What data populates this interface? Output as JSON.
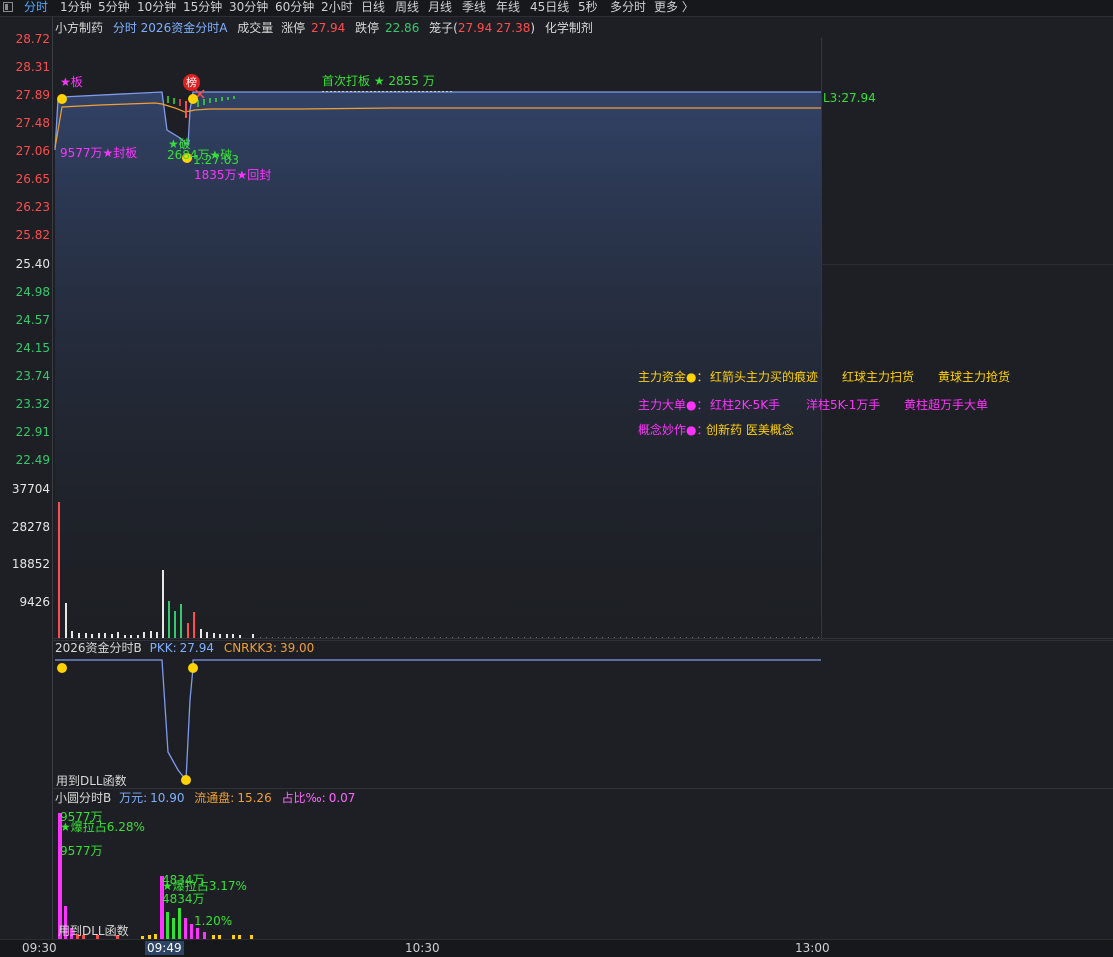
{
  "tabs": {
    "active_index": 0,
    "items": [
      "分时",
      "1分钟",
      "5分钟",
      "10分钟",
      "15分钟",
      "30分钟",
      "60分钟",
      "2小时",
      "日线",
      "周线",
      "月线",
      "季线",
      "年线",
      "45日线",
      "5秒",
      "多分时",
      "更多 〉"
    ]
  },
  "header": {
    "stock_name": "小方制药",
    "indicator": "分时 2026资金分时A",
    "volume_label": "成交量",
    "limit_up_label": "涨停",
    "limit_up_value": "27.94",
    "limit_down_label": "跌停",
    "limit_down_value": "22.86",
    "cage_label": "笼子(",
    "cage_value": "27.94 27.38",
    "cage_close": ")",
    "industry": "化学制剂"
  },
  "price_axis": [
    {
      "label": "28.72",
      "kind": "up"
    },
    {
      "label": "28.31",
      "kind": "up"
    },
    {
      "label": "27.89",
      "kind": "up"
    },
    {
      "label": "27.48",
      "kind": "up"
    },
    {
      "label": "27.06",
      "kind": "up"
    },
    {
      "label": "26.65",
      "kind": "up"
    },
    {
      "label": "26.23",
      "kind": "up"
    },
    {
      "label": "25.82",
      "kind": "up"
    },
    {
      "label": "25.40",
      "kind": "neutral"
    },
    {
      "label": "24.98",
      "kind": "down"
    },
    {
      "label": "24.57",
      "kind": "down"
    },
    {
      "label": "24.15",
      "kind": "down"
    },
    {
      "label": "23.74",
      "kind": "down"
    },
    {
      "label": "23.32",
      "kind": "down"
    },
    {
      "label": "22.91",
      "kind": "down"
    },
    {
      "label": "22.49",
      "kind": "down"
    }
  ],
  "volume_axis": [
    "37704",
    "28278",
    "18852",
    "9426"
  ],
  "annotations": {
    "board_star": "★板",
    "seal_text": "9577万★封板",
    "break_text": "★破",
    "break_text2": "2684万★破",
    "low_text": "1:27.03",
    "reseal_text": "1835万★回封",
    "bang_badge": "榜",
    "first_board": "首次打板 ★ 2855 万",
    "price_tag": "L3:27.94"
  },
  "legend_box": {
    "row1": [
      "主力资金●：",
      "红箭头主力买的痕迹",
      "红球主力扫货",
      "黄球主力抢货"
    ],
    "row2": [
      "主力大单●：",
      "红柱2K-5K手",
      "洋柱5K-1万手",
      "黄柱超万手大单"
    ],
    "row3": [
      "概念妙作●：",
      "创新药 医美概念"
    ]
  },
  "panel_b": {
    "title": "2026资金分时B",
    "pkk_label": "PKK:",
    "pkk_value": "27.94",
    "cnrkk_label": "CNRKK3:",
    "cnrkk_value": "39.00",
    "dll_text": "用到DLL函数"
  },
  "panel_c": {
    "title": "小圆分时B",
    "wan_label": "万元:",
    "wan_value": "10.90",
    "float_label": "流通盘:",
    "float_value": "15.26",
    "ratio_label": "占比‰:",
    "ratio_value": "0.07",
    "bar1_top": "9577万",
    "bar1_pct": "★爆拉占6.28%",
    "bar1_amt": "9577万",
    "bar2_top": "4834万",
    "bar2_pct": "★爆拉占3.17%",
    "bar2_amt": "4834万",
    "bar3_pct": "1.20%",
    "dll_text": "用到DLL函数"
  },
  "time_axis": [
    "09:30",
    "09:49",
    "10:30",
    "13:00"
  ],
  "colors": {
    "up": "#ff4d4d",
    "down": "#35c96d",
    "price_line": "#7f9bea",
    "avg_line": "#f0a030",
    "magenta": "#ff33ff",
    "yellow": "#ffd200",
    "green": "#35e035"
  }
}
